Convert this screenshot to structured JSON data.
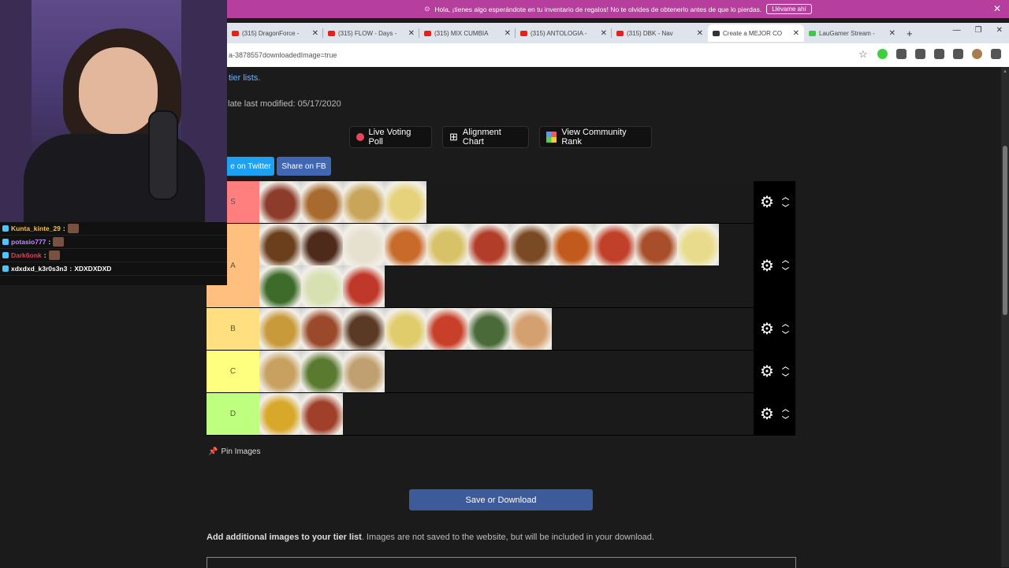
{
  "stream": {
    "chat": [
      {
        "user": "Kunta_kinte_29",
        "sep": " :",
        "color": "#f5c145",
        "msg": ""
      },
      {
        "user": "potasio777",
        "sep": " :",
        "color": "#c18aff",
        "msg": ""
      },
      {
        "user": "Dark6onk",
        "sep": " :",
        "color": "#e33d5a",
        "msg": ""
      },
      {
        "user": "xdxdxd_k3r0s3n3",
        "sep": " :",
        "color": "#ffffff",
        "msg": " XDXDXDXD"
      }
    ]
  },
  "notification": {
    "text": "Hola, ¡tienes algo esperándote en tu inventario de regalos! No te olvides de obtenerlo antes de que lo pierdas.",
    "button": "Llévame ahí",
    "close": "✕"
  },
  "tabs": [
    {
      "title": "(315) DragonForce - ",
      "fav": "yt"
    },
    {
      "title": "(315) FLOW - Days -",
      "fav": "yt"
    },
    {
      "title": "(315) MIX CUMBIA",
      "fav": "yt"
    },
    {
      "title": "(315) ANTOLOGIA - ",
      "fav": "yt"
    },
    {
      "title": "(315) DBK - Nav",
      "fav": "yt"
    },
    {
      "title": "Create a MEJOR CO",
      "fav": "blk"
    },
    {
      "title": "LauGamer Stream - ",
      "fav": "grn"
    }
  ],
  "newtab": "+",
  "window_controls": {
    "min": "—",
    "max": "❐",
    "close": "✕"
  },
  "address": {
    "url": "a-3878557downloadedImage=true"
  },
  "page": {
    "tier_lists_link": "tier lists.",
    "last_modified": "late last modified: 05/17/2020",
    "buttons": {
      "live_voting": "Live Voting Poll",
      "alignment": "Alignment Chart",
      "community": "View Community Rank"
    },
    "share_twitter": "e on Twitter",
    "share_fb": "Share on FB",
    "pin_images": "Pin Images",
    "save": "Save or Download",
    "add_images_bold": "Add additional images to your tier list",
    "add_images_rest": ". Images are not saved to the website, but will be included in your download."
  },
  "tiers": [
    {
      "label": "S",
      "color": "#ff7f7f",
      "items": 4,
      "foods": [
        "#8d3b2a",
        "#a86a2e",
        "#c9a55a",
        "#e6d27a"
      ]
    },
    {
      "label": "A",
      "color": "#ffbf7f",
      "items": 14,
      "foods": [
        "#6b3e1c",
        "#4e2a1a",
        "#e6e0cf",
        "#c86a2a",
        "#d8c268",
        "#b23e2a",
        "#7a4a25",
        "#c25a1d",
        "#c0402a",
        "#a84e2a",
        "#e8dc8c",
        "#3d6b2a",
        "#d6e0b0",
        "#c0382a"
      ]
    },
    {
      "label": "B",
      "color": "#ffdf7f",
      "items": 7,
      "foods": [
        "#c89a3a",
        "#9a4a2a",
        "#5a3a24",
        "#e0cc6a",
        "#c8402a",
        "#4a6a3a",
        "#d4a070"
      ]
    },
    {
      "label": "C",
      "color": "#ffff7f",
      "items": 3,
      "foods": [
        "#c8a060",
        "#5a7a30",
        "#c0a070"
      ]
    },
    {
      "label": "D",
      "color": "#bfff7f",
      "items": 2,
      "foods": [
        "#d8a82a",
        "#a0402a"
      ]
    }
  ]
}
